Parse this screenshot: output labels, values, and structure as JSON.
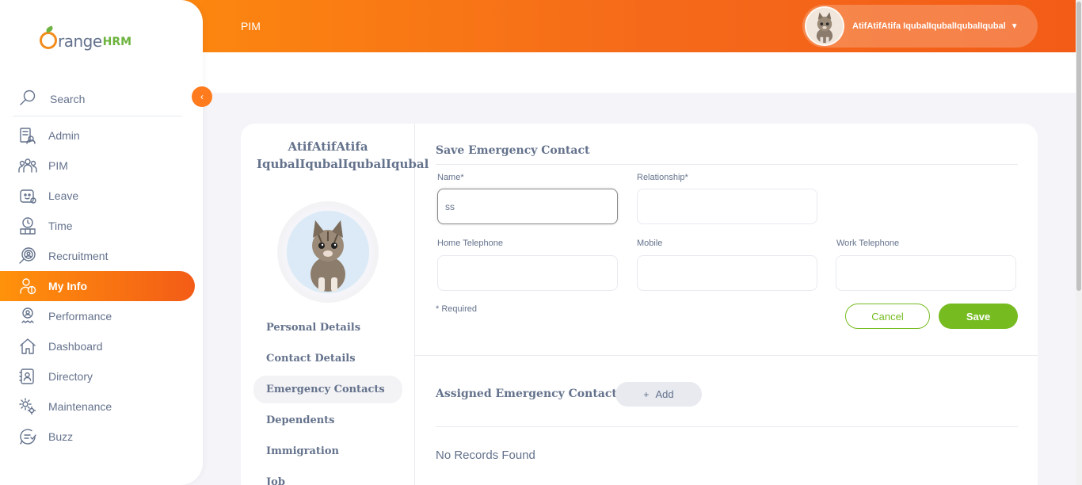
{
  "brand": {
    "text": "range",
    "hrm": "HRM"
  },
  "header": {
    "module_title": "PIM",
    "user_name": "AtifAtifAtifa IqubalIqubalIqubalIqubal",
    "caret": "▼"
  },
  "sidebar": {
    "collapse_icon": "‹",
    "search_label": "Search",
    "items": [
      {
        "label": "Admin",
        "icon": "admin-icon"
      },
      {
        "label": "PIM",
        "icon": "pim-icon"
      },
      {
        "label": "Leave",
        "icon": "leave-icon"
      },
      {
        "label": "Time",
        "icon": "time-icon"
      },
      {
        "label": "Recruitment",
        "icon": "recruitment-icon"
      },
      {
        "label": "My Info",
        "icon": "my-info-icon",
        "active": true
      },
      {
        "label": "Performance",
        "icon": "performance-icon"
      },
      {
        "label": "Dashboard",
        "icon": "dashboard-icon"
      },
      {
        "label": "Directory",
        "icon": "directory-icon"
      },
      {
        "label": "Maintenance",
        "icon": "maintenance-icon"
      },
      {
        "label": "Buzz",
        "icon": "buzz-icon"
      }
    ]
  },
  "employee": {
    "name": "AtifAtifAtifa IqubalIqubalIqubalIqubal"
  },
  "tabs": [
    {
      "label": "Personal Details"
    },
    {
      "label": "Contact Details"
    },
    {
      "label": "Emergency Contacts",
      "active": true
    },
    {
      "label": "Dependents"
    },
    {
      "label": "Immigration"
    },
    {
      "label": "Job"
    }
  ],
  "form": {
    "title": "Save Emergency Contact",
    "name_label": "Name*",
    "name_value": "ss",
    "relationship_label": "Relationship*",
    "relationship_value": "",
    "home_tel_label": "Home Telephone",
    "home_tel_value": "",
    "mobile_label": "Mobile",
    "mobile_value": "",
    "work_tel_label": "Work Telephone",
    "work_tel_value": "",
    "required_note": "* Required",
    "cancel_label": "Cancel",
    "save_label": "Save"
  },
  "assigned": {
    "title": "Assigned Emergency Contacts",
    "add_plus": "+",
    "add_label": "Add",
    "empty_text": "No Records Found"
  },
  "colors": {
    "accent_orange": "#ff7b1d",
    "accent_green": "#76bc21",
    "text": "#64728c"
  }
}
